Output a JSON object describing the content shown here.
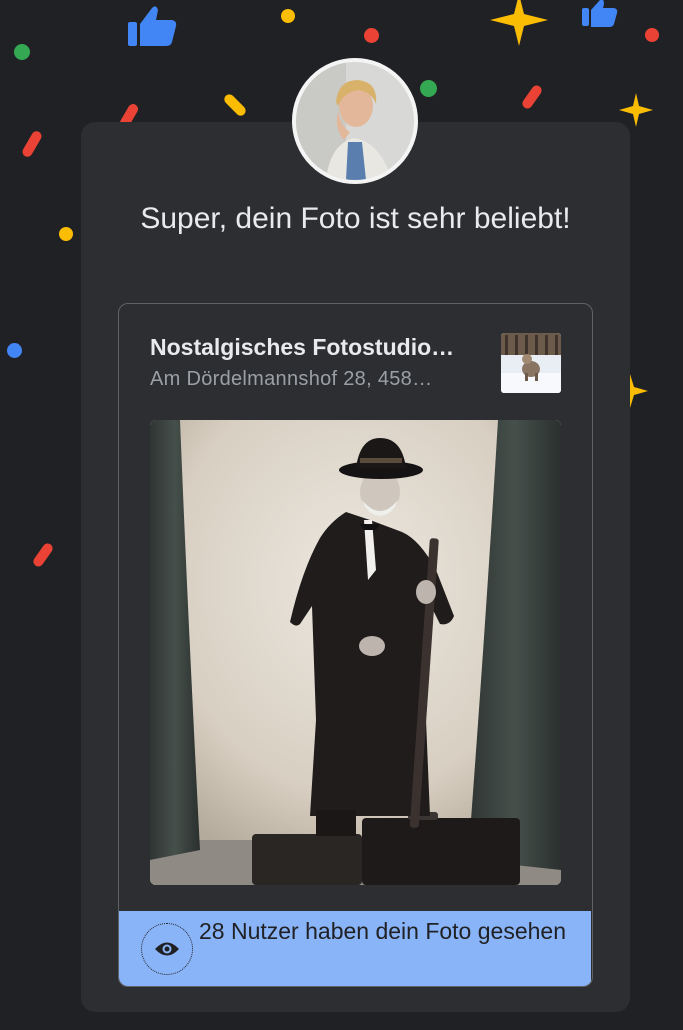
{
  "dialog": {
    "headline": "Super, dein Foto ist sehr beliebt!",
    "place": {
      "name": "Nostalgisches Fotostudio…",
      "address": "Am Dördelmannshof 28, 458…"
    },
    "views_text": "28 Nutzer haben dein Foto gesehen"
  },
  "icons": {
    "avatar": "profile-photo",
    "place_thumbnail": "place-photo-thumbnail",
    "eye": "eye-icon",
    "confetti": [
      "thumbs-up-icon",
      "star-icon"
    ]
  },
  "colors": {
    "background": "#202124",
    "card": "#2d2e31",
    "accent_blue": "#8ab4f8",
    "confetti_red": "#ea4335",
    "confetti_yellow": "#fbbc04",
    "confetti_green": "#34a853",
    "confetti_blue": "#4285f4"
  }
}
